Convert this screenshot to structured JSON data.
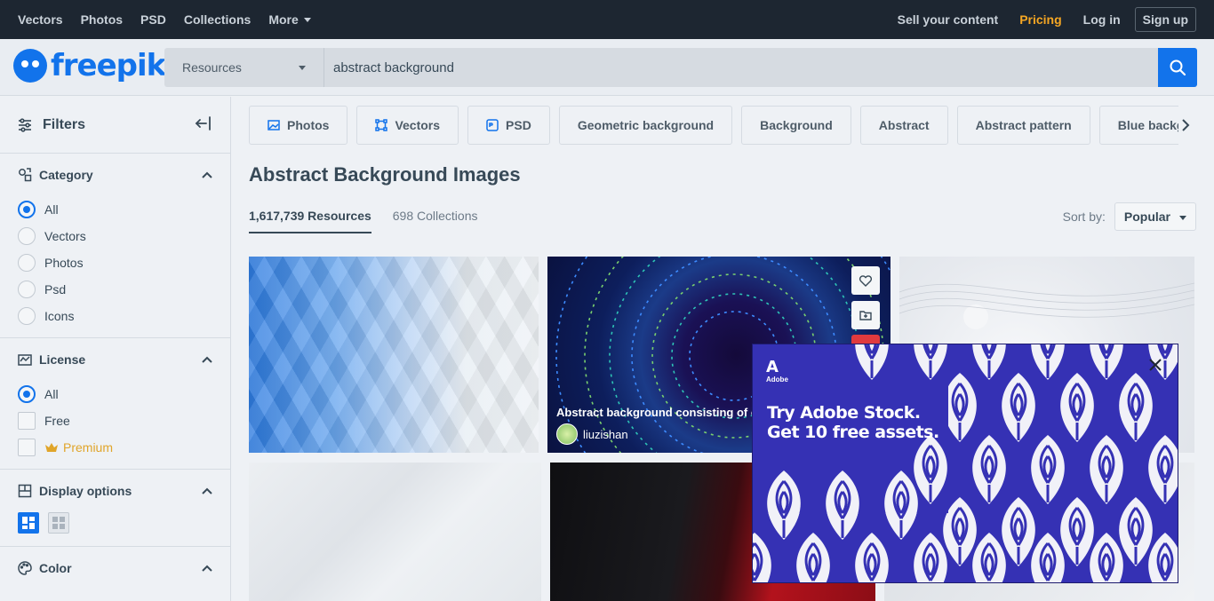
{
  "topnav": {
    "left": [
      "Vectors",
      "Photos",
      "PSD",
      "Collections",
      "More"
    ],
    "sell": "Sell your content",
    "pricing": "Pricing",
    "login": "Log in",
    "signup": "Sign up"
  },
  "logo": {
    "text": "freepik"
  },
  "search": {
    "resource_type": "Resources",
    "query": "abstract background"
  },
  "sidebar": {
    "title": "Filters",
    "category": {
      "label": "Category",
      "options": [
        "All",
        "Vectors",
        "Photos",
        "Psd",
        "Icons"
      ],
      "selected": "All"
    },
    "license": {
      "label": "License",
      "options": [
        "All",
        "Free",
        "Premium"
      ],
      "selected": "All"
    },
    "display": {
      "label": "Display options"
    },
    "color": {
      "label": "Color"
    }
  },
  "chips": [
    "Photos",
    "Vectors",
    "PSD",
    "Geometric background",
    "Background",
    "Abstract",
    "Abstract pattern",
    "Blue backgr"
  ],
  "page": {
    "title": "Abstract Background Images",
    "tab_resources": "1,617,739 Resources",
    "tab_collections": "698 Collections",
    "sort_label": "Sort by:",
    "sort_value": "Popular"
  },
  "featured": {
    "caption": "Abstract background consisting of c",
    "author": "liuzishan"
  },
  "ad": {
    "brand": "Adobe",
    "line1": "Try Adobe Stock.",
    "line2": "Get 10 free assets.",
    "colors": {
      "bg": "#3531b4",
      "leaf": "#f1f1f8"
    }
  }
}
